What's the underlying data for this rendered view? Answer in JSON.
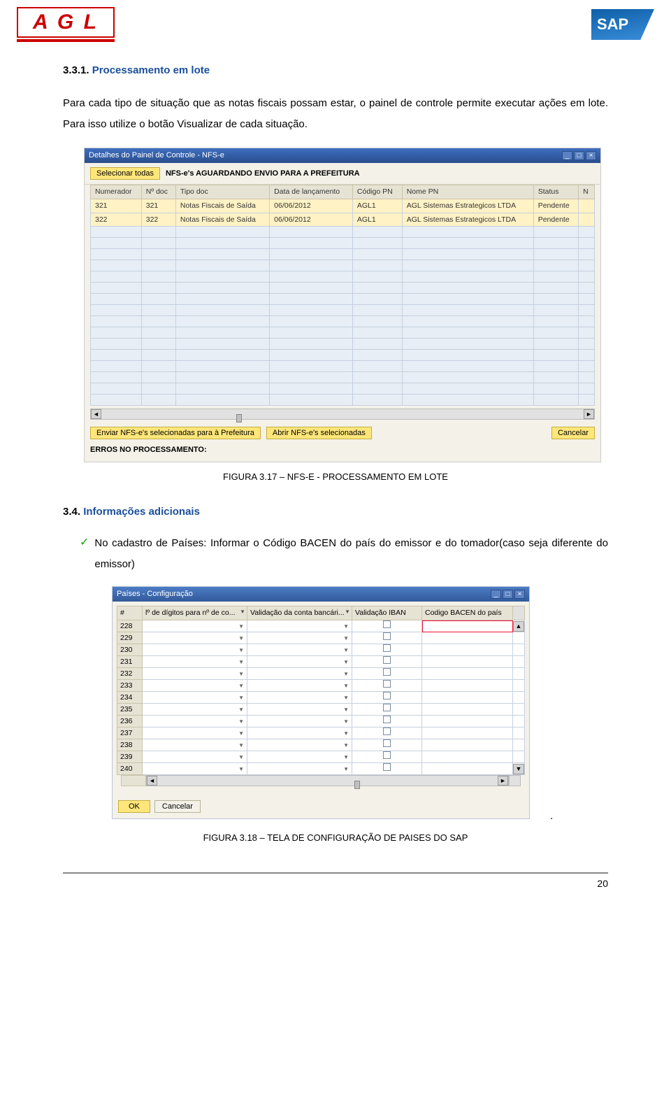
{
  "header": {
    "agl_letters": "A G L",
    "sap_text": "SAP"
  },
  "section": {
    "number": "3.3.1.",
    "title": "Processamento em lote",
    "body": "Para cada tipo de situação que as notas fiscais possam estar, o painel de controle permite executar ações em lote. Para isso utilize o botão Visualizar de cada situação."
  },
  "screenshot1": {
    "title": "Detalhes do Painel de Controle - NFS-e",
    "select_all": "Selecionar todas",
    "status_text": "NFS-e's AGUARDANDO ENVIO PARA A PREFEITURA",
    "columns": [
      "Numerador",
      "Nº doc",
      "Tipo doc",
      "Data de lançamento",
      "Código PN",
      "Nome PN",
      "Status",
      "N"
    ],
    "rows": [
      {
        "num": "321",
        "doc": "321",
        "tipo": "Notas Fiscais de Saída",
        "data": "06/06/2012",
        "cod": "AGL1",
        "nome": "AGL Sistemas Estrategicos LTDA",
        "status": "Pendente"
      },
      {
        "num": "322",
        "doc": "322",
        "tipo": "Notas Fiscais de Saída",
        "data": "06/06/2012",
        "cod": "AGL1",
        "nome": "AGL Sistemas Estrategicos LTDA",
        "status": "Pendente"
      }
    ],
    "btn_enviar": "Enviar NFS-e's selecionadas para à Prefeitura",
    "btn_abrir": "Abrir NFS-e's selecionadas",
    "btn_cancelar": "Cancelar",
    "erros_label": "ERROS NO PROCESSAMENTO:"
  },
  "caption1": "FIGURA 3.17 – NFS-E - PROCESSAMENTO EM LOTE",
  "subsection": {
    "number": "3.4.",
    "title": "Informações adicionais",
    "check_text": "No cadastro de Países: Informar o Código BACEN do país do emissor e do tomador(caso seja diferente do emissor)"
  },
  "screenshot2": {
    "title": "Países - Configuração",
    "columns": [
      "#",
      "lº de dígitos para nº de co...",
      "Validação da conta bancári...",
      "Validação IBAN",
      "Codigo BACEN do país"
    ],
    "row_nums": [
      "228",
      "229",
      "230",
      "231",
      "232",
      "233",
      "234",
      "235",
      "236",
      "237",
      "238",
      "239",
      "240"
    ],
    "btn_ok": "OK",
    "btn_cancel": "Cancelar"
  },
  "caption2": "FIGURA 3.18 – TELA DE CONFIGURAÇÃO DE PAISES DO SAP",
  "dot": ".",
  "page_number": "20"
}
